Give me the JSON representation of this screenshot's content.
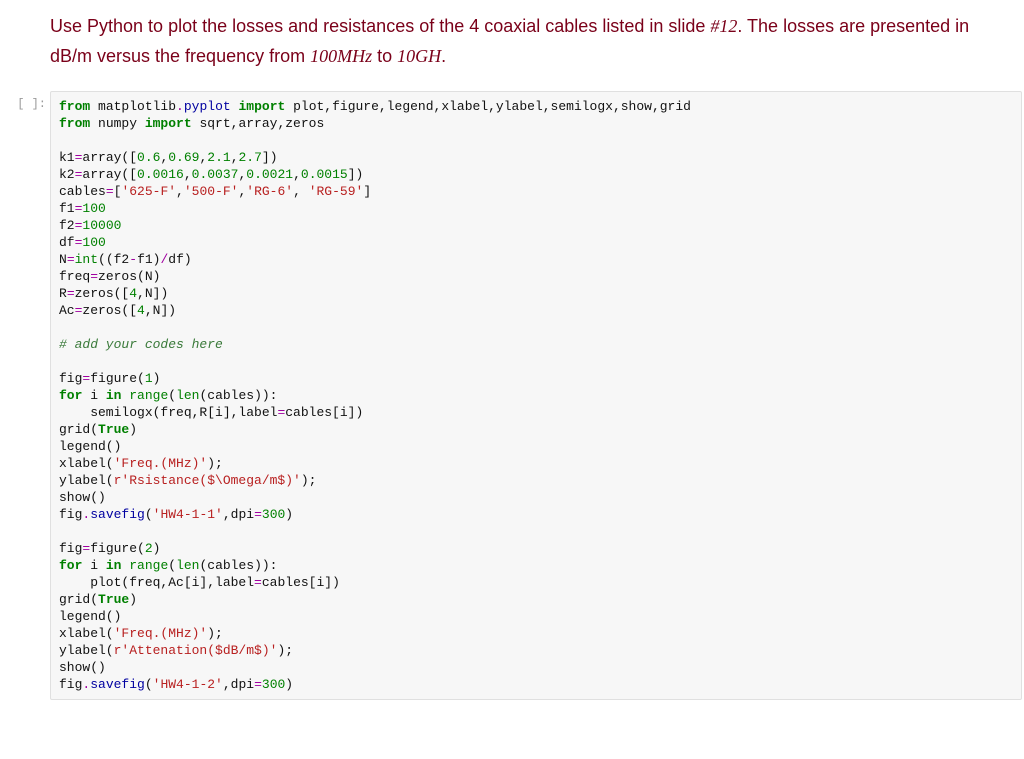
{
  "problem": {
    "prefix": "Use Python to plot the losses and resistances of the 4 coaxial cables listed in slide ",
    "slide_ref": "#12",
    "middle": ". The losses are presented in dB/m versus the frequency from ",
    "freq_low": "100MHz",
    "to": " to ",
    "freq_high": "10GH",
    "suffix": "."
  },
  "cell": {
    "prompt": "[ ]:"
  },
  "code": {
    "l01_a": "from",
    "l01_b": " matplotlib",
    "l01_c": ".",
    "l01_d": "pyplot",
    "l01_e": " ",
    "l01_f": "import",
    "l01_g": " plot,figure,legend,xlabel,ylabel,semilogx,show,grid",
    "l02_a": "from",
    "l02_b": " numpy ",
    "l02_c": "import",
    "l02_d": " sqrt,array,zeros",
    "l03": "",
    "l04_a": "k1",
    "l04_b": "=",
    "l04_c": "array([",
    "l04_d": "0.6",
    "l04_e": ",",
    "l04_f": "0.69",
    "l04_g": ",",
    "l04_h": "2.1",
    "l04_i": ",",
    "l04_j": "2.7",
    "l04_k": "])",
    "l05_a": "k2",
    "l05_b": "=",
    "l05_c": "array([",
    "l05_d": "0.0016",
    "l05_e": ",",
    "l05_f": "0.0037",
    "l05_g": ",",
    "l05_h": "0.0021",
    "l05_i": ",",
    "l05_j": "0.0015",
    "l05_k": "])",
    "l06_a": "cables",
    "l06_b": "=",
    "l06_c": "[",
    "l06_d": "'625-F'",
    "l06_e": ",",
    "l06_f": "'500-F'",
    "l06_g": ",",
    "l06_h": "'RG-6'",
    "l06_i": ", ",
    "l06_j": "'RG-59'",
    "l06_k": "]",
    "l07_a": "f1",
    "l07_b": "=",
    "l07_c": "100",
    "l08_a": "f2",
    "l08_b": "=",
    "l08_c": "10000",
    "l09_a": "df",
    "l09_b": "=",
    "l09_c": "100",
    "l10_a": "N",
    "l10_b": "=",
    "l10_c": "int",
    "l10_d": "((f2",
    "l10_e": "-",
    "l10_f": "f1)",
    "l10_g": "/",
    "l10_h": "df)",
    "l11_a": "freq",
    "l11_b": "=",
    "l11_c": "zeros(N)",
    "l12_a": "R",
    "l12_b": "=",
    "l12_c": "zeros([",
    "l12_d": "4",
    "l12_e": ",N])",
    "l13_a": "Ac",
    "l13_b": "=",
    "l13_c": "zeros([",
    "l13_d": "4",
    "l13_e": ",N])",
    "l14": "",
    "l15": "# add your codes here",
    "l16": "",
    "l17_a": "fig",
    "l17_b": "=",
    "l17_c": "figure(",
    "l17_d": "1",
    "l17_e": ")",
    "l18_a": "for",
    "l18_b": " i ",
    "l18_c": "in",
    "l18_d": " ",
    "l18_e": "range",
    "l18_f": "(",
    "l18_g": "len",
    "l18_h": "(cables)):",
    "l19_a": "    semilogx(freq,R[i],label",
    "l19_b": "=",
    "l19_c": "cables[i])",
    "l20_a": "grid(",
    "l20_b": "True",
    "l20_c": ")",
    "l21": "legend()",
    "l22_a": "xlabel(",
    "l22_b": "'Freq.(MHz)'",
    "l22_c": ");",
    "l23_a": "ylabel(",
    "l23_b": "r'Rsistance($\\Omega/m$)'",
    "l23_c": ");",
    "l24": "show()",
    "l25_a": "fig",
    "l25_b": ".",
    "l25_c": "savefig",
    "l25_d": "(",
    "l25_e": "'HW4-1-1'",
    "l25_f": ",dpi",
    "l25_g": "=",
    "l25_h": "300",
    "l25_i": ")",
    "l26": "",
    "l27_a": "fig",
    "l27_b": "=",
    "l27_c": "figure(",
    "l27_d": "2",
    "l27_e": ")",
    "l28_a": "for",
    "l28_b": " i ",
    "l28_c": "in",
    "l28_d": " ",
    "l28_e": "range",
    "l28_f": "(",
    "l28_g": "len",
    "l28_h": "(cables)):",
    "l29_a": "    plot(freq,Ac[i],label",
    "l29_b": "=",
    "l29_c": "cables[i])",
    "l30_a": "grid(",
    "l30_b": "True",
    "l30_c": ")",
    "l31": "legend()",
    "l32_a": "xlabel(",
    "l32_b": "'Freq.(MHz)'",
    "l32_c": ");",
    "l33_a": "ylabel(",
    "l33_b": "r'Attenation($dB/m$)'",
    "l33_c": ");",
    "l34": "show()",
    "l35_a": "fig",
    "l35_b": ".",
    "l35_c": "savefig",
    "l35_d": "(",
    "l35_e": "'HW4-1-2'",
    "l35_f": ",dpi",
    "l35_g": "=",
    "l35_h": "300",
    "l35_i": ")"
  }
}
